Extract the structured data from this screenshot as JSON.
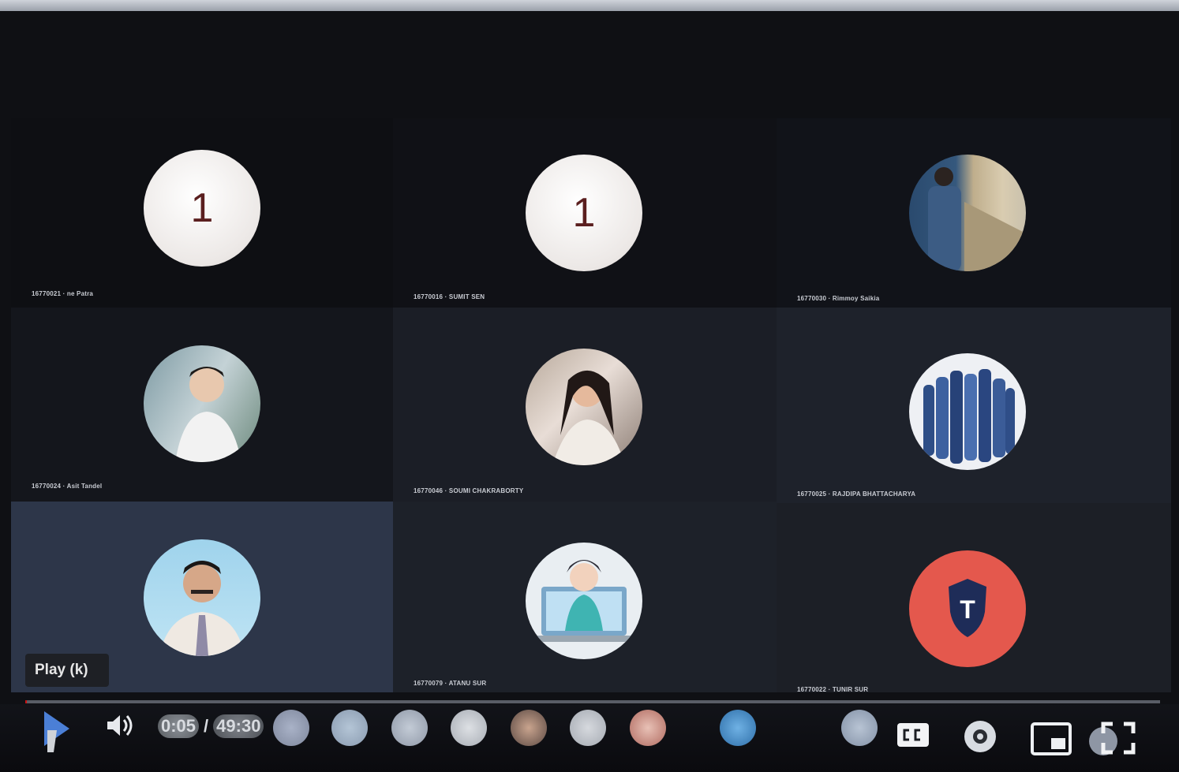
{
  "meeting": {
    "participants": [
      {
        "name": "16770021 · ne Patra",
        "avatar_text": "1",
        "avatar_kind": "number"
      },
      {
        "name": "16770016 · SUMIT SEN",
        "avatar_text": "1",
        "avatar_kind": "number"
      },
      {
        "name": "16770030 · Rimmoy Saikia",
        "avatar_kind": "photo-outdoor"
      },
      {
        "name": "16770024 · Asit Tandel",
        "avatar_kind": "photo-boy"
      },
      {
        "name": "16770046 · SOUMI CHAKRABORTY",
        "avatar_kind": "photo-girl"
      },
      {
        "name": "16770025 · RAJDIPA BHATTACHARYA",
        "avatar_kind": "photo-group"
      },
      {
        "name": "",
        "avatar_kind": "photo-man"
      },
      {
        "name": "16770079 · ATANU SUR",
        "avatar_kind": "cartoon"
      },
      {
        "name": "16770022 · TUNIR SUR",
        "avatar_text": "T",
        "avatar_kind": "shield"
      }
    ]
  },
  "player": {
    "tooltip": "Play (k)",
    "time_current": "0:05",
    "time_separator": "/",
    "time_duration": "49:30",
    "progress_fraction": 0.0017
  },
  "colors": {
    "tile_dark": "#0f1014",
    "tile_mid": "#1a1d24",
    "tile_blue": "#2b3447",
    "shield_bg": "#e4584d",
    "accent_red": "#cc1111"
  }
}
